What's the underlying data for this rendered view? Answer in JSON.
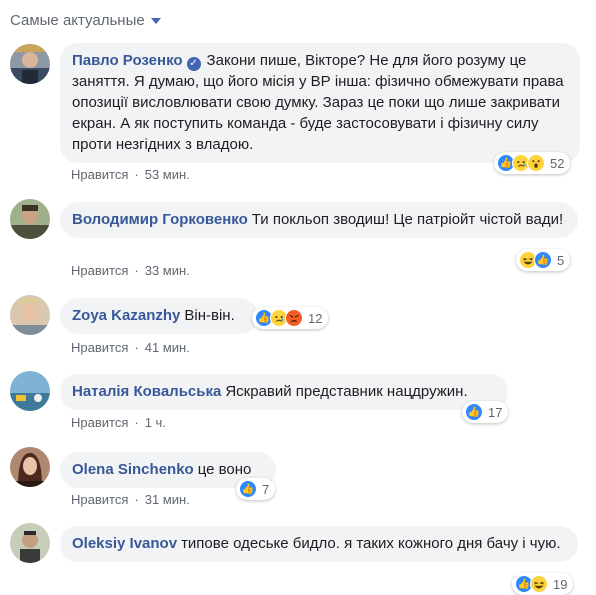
{
  "sort": {
    "label": "Самые актуальные"
  },
  "colors": {
    "author": "#385898",
    "bubble": "#f2f3f5",
    "meta": "#606770",
    "like": "#2e89ff"
  },
  "comments": [
    {
      "author": "Павло Розенко",
      "verified": true,
      "text": "Закони пише, Вікторе? Не для його розуму це заняття. Я думаю, що його місія у ВР інша: фізично обмежувати права опозиції висловлювати свою думку. Зараз це поки що лише закривати екран. А як поступить команда - буде застосовувати і фізичну силу проти незгідних з владою.",
      "like_label": "Нравится",
      "time": "53 мин.",
      "reactions": [
        "like-icon",
        "sad-icon",
        "wow-icon"
      ],
      "reaction_count": "52"
    },
    {
      "author": "Володимир Горковенко",
      "verified": false,
      "text": "Ти покльоп зводиш! Це патріойт чістой вади!",
      "like_label": "Нравится",
      "time": "33 мин.",
      "reactions": [
        "haha-icon",
        "like-icon"
      ],
      "reaction_count": "5"
    },
    {
      "author": "Zoya Kazanzhy",
      "verified": false,
      "text": "Він-він.",
      "like_label": "Нравится",
      "time": "41 мин.",
      "reactions": [
        "like-icon",
        "sad-icon",
        "angry-icon"
      ],
      "reaction_count": "12"
    },
    {
      "author": "Наталія Ковальська",
      "verified": false,
      "text": "Яскравий представник нацдружин.",
      "like_label": "Нравится",
      "time": "1 ч.",
      "reactions": [
        "like-icon"
      ],
      "reaction_count": "17"
    },
    {
      "author": "Olena Sinchenko",
      "verified": false,
      "text": "це воно",
      "like_label": "Нравится",
      "time": "31 мин.",
      "reactions": [
        "like-icon"
      ],
      "reaction_count": "7"
    },
    {
      "author": "Oleksiy Ivanov",
      "verified": false,
      "text": "типове одеське бидло. я таких кожного дня бачу і чую.",
      "like_label": "",
      "time": "",
      "reactions": [
        "like-icon",
        "haha-icon"
      ],
      "reaction_count": "19"
    }
  ]
}
